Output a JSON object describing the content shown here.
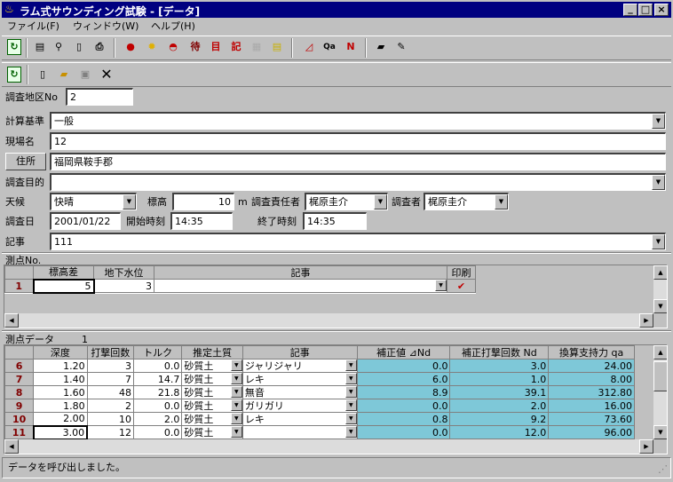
{
  "window": {
    "title": "ラム式サウンディング試験 - [データ]",
    "min": "_",
    "max": "□",
    "close": "×"
  },
  "menu": [
    "ファイル(F)",
    "ウィンドウ(W)",
    "ヘルプ(H)"
  ],
  "toolbar_icons": [
    "open-icon",
    "list-icon",
    "binoculars-icon",
    "preview-icon",
    "print-icon",
    "red-apple-icon",
    "sun-icon",
    "dome-icon",
    "待",
    "目",
    "記",
    "grid-icon",
    "memo-icon",
    "chart-icon",
    "Qa",
    "N-chart-icon",
    "notebook-icon",
    "pen-icon"
  ],
  "toolbar2_icons": [
    "refresh-icon",
    "new-icon",
    "folder-open-icon",
    "save-icon",
    "delete-icon"
  ],
  "form": {
    "area_label": "調査地区No",
    "area_value": "2",
    "standard_label": "計算基準",
    "standard_value": "一般",
    "site_label": "現場名",
    "site_value": "12",
    "address_button": "住所",
    "address_value": "福岡県鞍手郡",
    "purpose_label": "調査目的",
    "purpose_value": "",
    "weather_label": "天候",
    "weather_value": "快晴",
    "elevation_label": "標高",
    "elevation_value": "10",
    "elevation_unit": "m",
    "manager_label": "調査責任者",
    "manager_value": "梶原圭介",
    "surveyor_label": "調査者",
    "surveyor_value": "梶原圭介",
    "date_label": "調査日",
    "date_value": "2001/01/22",
    "start_label": "開始時刻",
    "start_value": "14:35",
    "end_label": "終了時刻",
    "end_value": "14:35",
    "note_label": "記事",
    "note_value": "111"
  },
  "points": {
    "title": "測点No.",
    "headers": [
      "標高差",
      "地下水位",
      "記事",
      "印刷"
    ],
    "rows": [
      {
        "no": "1",
        "elev": "5",
        "water": "3",
        "note": ""
      }
    ]
  },
  "measure": {
    "title": "測点データ",
    "count": "1",
    "headers": [
      "深度",
      "打撃回数",
      "トルク",
      "推定土質",
      "記事",
      "補正値 ⊿Nd",
      "補正打撃回数 Nd",
      "換算支持力 qa"
    ],
    "rows": [
      {
        "no": "6",
        "depth": "1.20",
        "blows": "3",
        "torque": "0.0",
        "soil": "砂質土",
        "note": "ジャリジャリ",
        "corr": "0.0",
        "nd": "3.0",
        "qa": "24.00"
      },
      {
        "no": "7",
        "depth": "1.40",
        "blows": "7",
        "torque": "14.7",
        "soil": "砂質土",
        "note": "レキ",
        "corr": "6.0",
        "nd": "1.0",
        "qa": "8.00"
      },
      {
        "no": "8",
        "depth": "1.60",
        "blows": "48",
        "torque": "21.8",
        "soil": "砂質土",
        "note": "無音",
        "corr": "8.9",
        "nd": "39.1",
        "qa": "312.80"
      },
      {
        "no": "9",
        "depth": "1.80",
        "blows": "2",
        "torque": "0.0",
        "soil": "砂質土",
        "note": "ガリガリ",
        "corr": "0.0",
        "nd": "2.0",
        "qa": "16.00"
      },
      {
        "no": "10",
        "depth": "2.00",
        "blows": "10",
        "torque": "2.0",
        "soil": "砂質土",
        "note": "レキ",
        "corr": "0.8",
        "nd": "9.2",
        "qa": "73.60"
      },
      {
        "no": "11",
        "depth": "3.00",
        "blows": "12",
        "torque": "0.0",
        "soil": "砂質土",
        "note": "",
        "corr": "0.0",
        "nd": "12.0",
        "qa": "96.00"
      }
    ]
  },
  "status": "データを呼び出しました。",
  "colors": {
    "titlebar": "#000080",
    "highlight": "#7ec8d8",
    "face": "#c0c0c0"
  }
}
